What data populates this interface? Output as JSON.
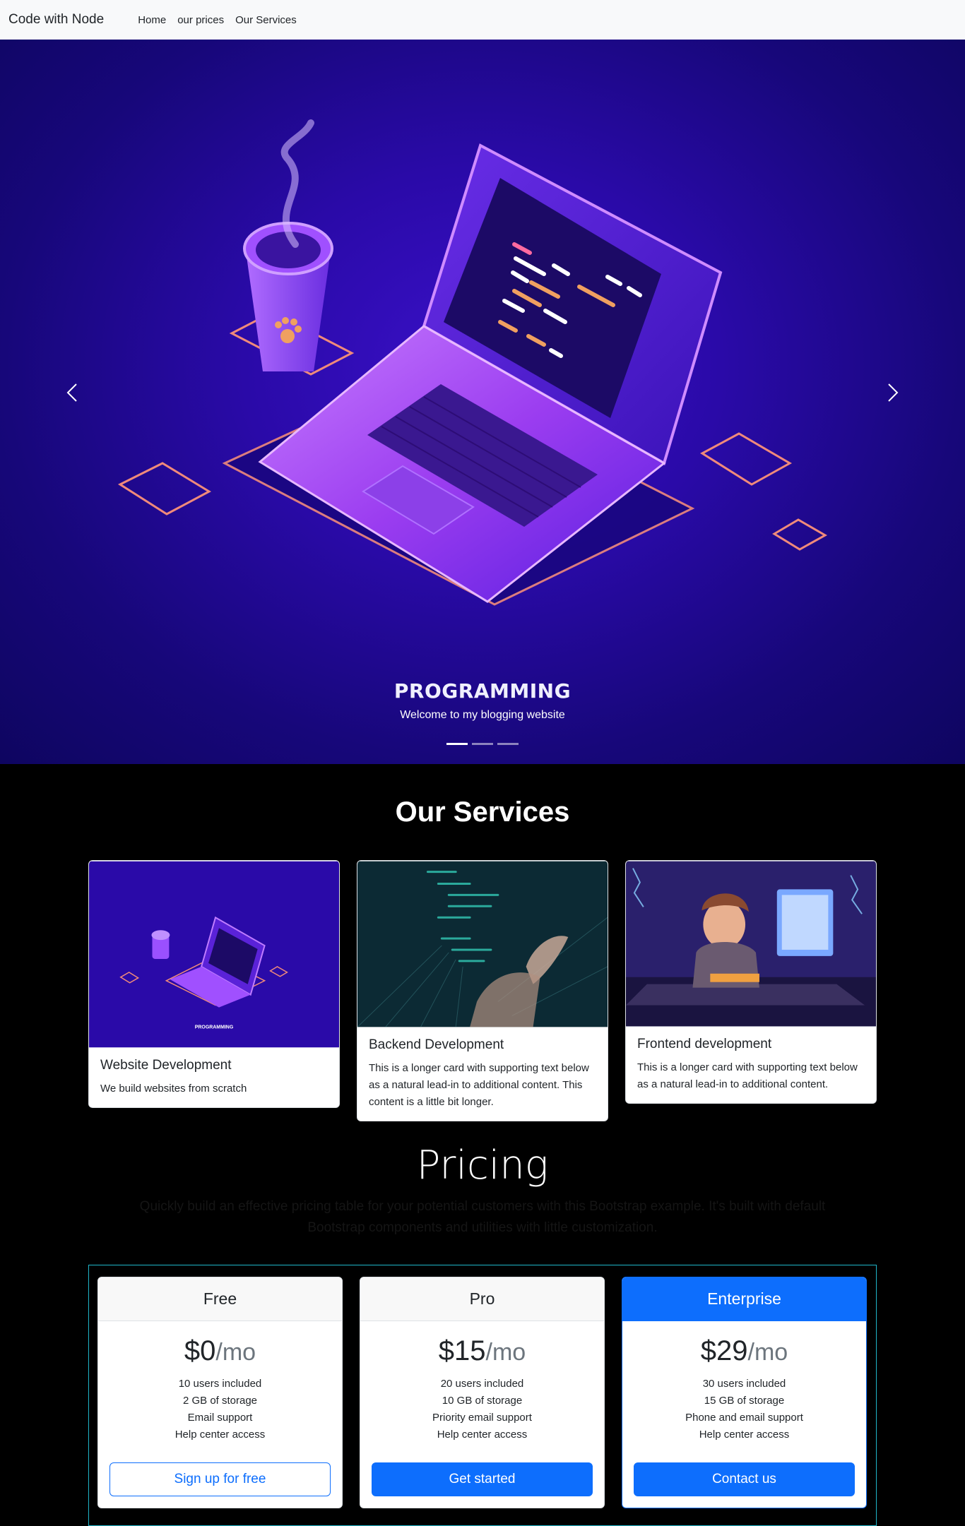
{
  "navbar": {
    "brand": "Code with Node",
    "links": [
      "Home",
      "our prices",
      "Our Services"
    ]
  },
  "carousel": {
    "image_text": "PROGRAMMING",
    "caption_text": "Welcome to my blogging website",
    "prev_icon": "chevron-left-icon",
    "next_icon": "chevron-right-icon",
    "slide_count": 3,
    "active_slide": 1
  },
  "services": {
    "title": "Our Services",
    "cards": [
      {
        "title": "Website Development",
        "text": "We build websites from scratch",
        "thumb_text": "PROGRAMMING"
      },
      {
        "title": "Backend Development",
        "text": "This is a longer card with supporting text below as a natural lead-in to additional content. This content is a little bit longer."
      },
      {
        "title": "Frontend development",
        "text": "This is a longer card with supporting text below as a natural lead-in to additional content."
      }
    ]
  },
  "pricing": {
    "title": "Pricing",
    "lead": "Quickly build an effective pricing table for your potential customers with this Bootstrap example. It's built with default Bootstrap components and utilities with little customization.",
    "plans": [
      {
        "name": "Free",
        "price": "$0",
        "period": "/mo",
        "features": [
          "10 users included",
          "2 GB of storage",
          "Email support",
          "Help center access"
        ],
        "button": "Sign up for free"
      },
      {
        "name": "Pro",
        "price": "$15",
        "period": "/mo",
        "features": [
          "20 users included",
          "10 GB of storage",
          "Priority email support",
          "Help center access"
        ],
        "button": "Get started"
      },
      {
        "name": "Enterprise",
        "price": "$29",
        "period": "/mo",
        "features": [
          "30 users included",
          "15 GB of storage",
          "Phone and email support",
          "Help center access"
        ],
        "button": "Contact us"
      }
    ]
  },
  "colors": {
    "primary": "#0d6efd",
    "navbar_bg": "#f8f9fa",
    "hero_bg": "#2a0aa8",
    "page_bg": "#000000"
  }
}
